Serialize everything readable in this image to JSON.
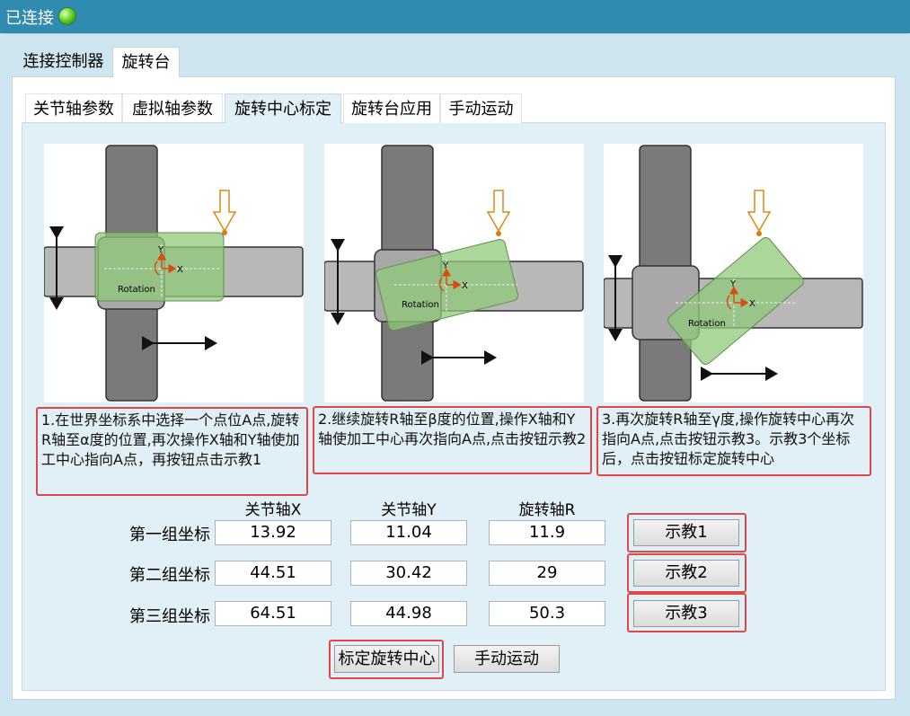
{
  "title": {
    "status": "已连接",
    "led_color": "#4cc51a"
  },
  "outer_tabs": [
    "连接控制器",
    "旋转台"
  ],
  "inner_tabs": [
    "关节轴参数",
    "虚拟轴参数",
    "旋转中心标定",
    "旋转台应用",
    "手动运动"
  ],
  "diagrams": [
    {
      "label_rotation": "Rotation",
      "label_x": "X",
      "label_y": "Y"
    },
    {
      "label_rotation": "Rotation",
      "label_x": "X",
      "label_y": "Y"
    },
    {
      "label_rotation": "Rotation",
      "label_x": "X",
      "label_y": "Y"
    }
  ],
  "steps": [
    "1.在世界坐标系中选择一个点位A点,旋转R轴至α度的位置,再次操作X轴和Y轴使加工中心指向A点，再按钮点击示教1",
    "2.继续旋转R轴至β度的位置,操作X轴和Y轴使加工中心再次指向A点,点击按钮示教2",
    "3.再次旋转R轴至γ度,操作旋转中心再次指向A点,点击按钮示教3。示教3个坐标后，点击按钮标定旋转中心"
  ],
  "columns": [
    "关节轴X",
    "关节轴Y",
    "旋转轴R"
  ],
  "rows": [
    {
      "label": "第一组坐标",
      "x": "13.92",
      "y": "11.04",
      "r": "11.9",
      "button": "示教1"
    },
    {
      "label": "第二组坐标",
      "x": "44.51",
      "y": "30.42",
      "r": "29",
      "button": "示教2"
    },
    {
      "label": "第三组坐标",
      "x": "64.51",
      "y": "44.98",
      "r": "50.3",
      "button": "示教3"
    }
  ],
  "actions": {
    "calibrate": "标定旋转中心",
    "manual": "手动运动"
  },
  "colors": {
    "highlight": "#e04848",
    "title_bar": "#2f8bb0",
    "plate": "#8fc97a"
  }
}
